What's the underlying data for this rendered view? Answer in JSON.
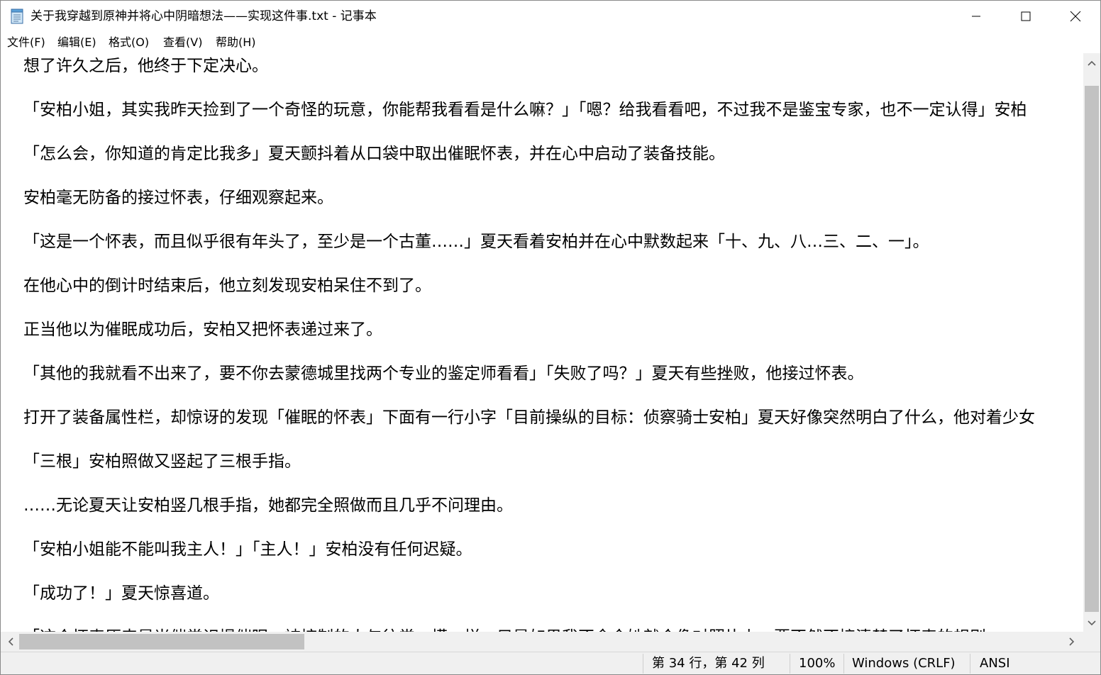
{
  "window": {
    "title": "关于我穿越到原神并将心中阴暗想法——实现这件事.txt - 记事本"
  },
  "menu": [
    {
      "label": "文件(F)"
    },
    {
      "label": "编辑(E)"
    },
    {
      "label": "格式(O)"
    },
    {
      "label": "查看(V)"
    },
    {
      "label": "帮助(H)"
    }
  ],
  "editor": {
    "lines": [
      "想了许久之后，他终于下定决心。",
      "「安柏小姐，其实我昨天捡到了一个奇怪的玩意，你能帮我看看是什么嘛？」「嗯？给我看看吧，不过我不是鉴宝专家，也不一定认得」安柏",
      "「怎么会，你知道的肯定比我多」夏天颤抖着从口袋中取出催眠怀表，并在心中启动了装备技能。",
      "安柏毫无防备的接过怀表，仔细观察起来。",
      "「这是一个怀表，而且似乎很有年头了，至少是一个古董……」夏天看着安柏并在心中默数起来「十、九、八…三、二、一」。",
      "在他心中的倒计时结束后，他立刻发现安柏呆住不到了。",
      "正当他以为催眠成功后，安柏又把怀表递过来了。",
      "「其他的我就看不出来了，要不你去蒙德城里找两个专业的鉴定师看看」「失败了吗？」夏天有些挫败，他接过怀表。",
      "打开了装备属性栏，却惊讶的发现「催眠的怀表」下面有一行小字「目前操纵的目标：侦察骑士安柏」夏天好像突然明白了什么，他对着少女",
      "「三根」安柏照做又竖起了三根手指。",
      "……无论夏天让安柏竖几根手指，她都完全照做而且几乎不问理由。",
      "「安柏小姐能不能叫我主人！」「主人！」安柏没有任何迟疑。",
      "「成功了！」夏天惊喜道。",
      "「这个怀表原来是当催常识提催眠，被控制的人与往常一模一样，只是如果我不命令她就会像对照片上，要不然不接清楚了怀表的规则"
    ]
  },
  "status": {
    "position": "第 34 行，第 42 列",
    "zoom": "100%",
    "line_ending": "Windows (CRLF)",
    "encoding": "ANSI"
  }
}
